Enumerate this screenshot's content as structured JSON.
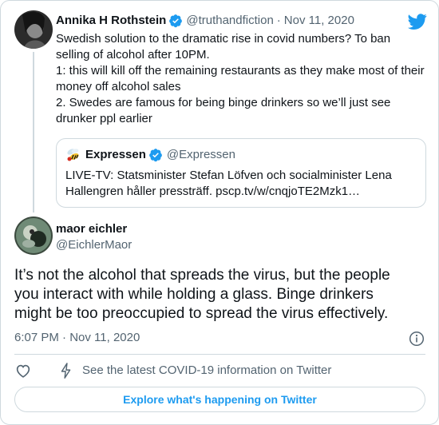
{
  "colors": {
    "accent": "#1d9bf0",
    "text": "#0f1419",
    "secondary": "#536471",
    "border": "#cfd9de"
  },
  "icons": {
    "brand": "twitter-bird-icon",
    "verified": "verified-badge-icon",
    "embed_logo": "expressen-wasp-icon",
    "info": "info-icon",
    "like": "heart-icon",
    "covid": "lightning-bolt-icon"
  },
  "quoted_tweet": {
    "author_name": "Annika H Rothstein",
    "author_handle": "@truthandfiction",
    "separator": "·",
    "date": "Nov 11, 2020",
    "lines": [
      "Swedish solution to the dramatic rise in covid numbers? To ban",
      "selling of alcohol after 10PM.",
      "1: this will kill off the remaining restaurants as they make most of their",
      "money off alcohol sales",
      "2. Swedes are famous for being binge drinkers so we’ll just see",
      "drunker ppl earlier"
    ],
    "embed": {
      "name": "Expressen",
      "handle": "@Expressen",
      "line1": "LIVE-TV: Statsminister Stefan Löfven och socialminister Lena",
      "line2": "Hallengren håller pressträff. pscp.tv/w/cnqjoTE2Mzk1…"
    }
  },
  "main_tweet": {
    "author_name": "maor eichler",
    "author_handle": "@EichlerMaor",
    "lines": [
      "It’s not the alcohol that spreads the virus, but the people",
      "you interact with while holding a glass. Binge drinkers",
      "might be too preoccupied to spread the virus effectively."
    ],
    "timestamp": "6:07 PM · Nov 11, 2020"
  },
  "actions": {
    "covid_label": "See the latest COVID-19 information on Twitter"
  },
  "footer": {
    "explore_label": "Explore what's happening on Twitter"
  }
}
